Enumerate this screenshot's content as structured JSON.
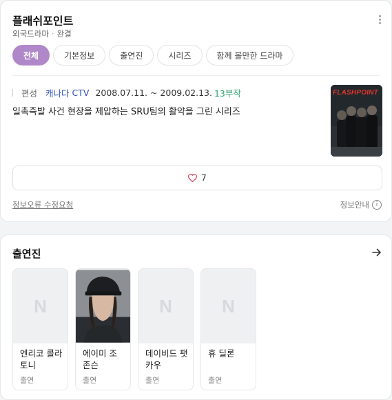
{
  "show": {
    "title": "플래쉬포인트",
    "genre": "외국드라마",
    "status": "완결"
  },
  "tabs": [
    {
      "label": "전체",
      "active": true
    },
    {
      "label": "기본정보",
      "active": false
    },
    {
      "label": "출연진",
      "active": false
    },
    {
      "label": "시리즈",
      "active": false
    },
    {
      "label": "함께 볼만한 드라마",
      "active": false
    }
  ],
  "info": {
    "label": "편성",
    "country": "캐나다",
    "channel": "CTV",
    "dates": "2008.07.11. ~ 2009.02.13.",
    "episodes": "13부작",
    "description": "일촉즉발 사건 현장을 제압하는 SRU팀의 활약을 그린 시리즈",
    "poster_title": "FLASHPOINT"
  },
  "like": {
    "count": "7"
  },
  "footer": {
    "report": "정보오류 수정요청",
    "guide": "정보안내",
    "guide_icon": "i"
  },
  "cast": {
    "title": "출연진",
    "people": [
      {
        "name": "엔리코 콜라토니",
        "role": "출연",
        "photo": false,
        "placeholder": "N"
      },
      {
        "name": "에이미 조 존슨",
        "role": "출연",
        "photo": true,
        "placeholder": ""
      },
      {
        "name": "데이비드 팻카우",
        "role": "출연",
        "photo": false,
        "placeholder": "N"
      },
      {
        "name": "휴 딜론",
        "role": "출연",
        "photo": false,
        "placeholder": "N"
      }
    ]
  },
  "colors": {
    "accent": "#b088c9",
    "link": "#2f50b5",
    "episode": "#2aa070",
    "heart": "#e0415a"
  }
}
